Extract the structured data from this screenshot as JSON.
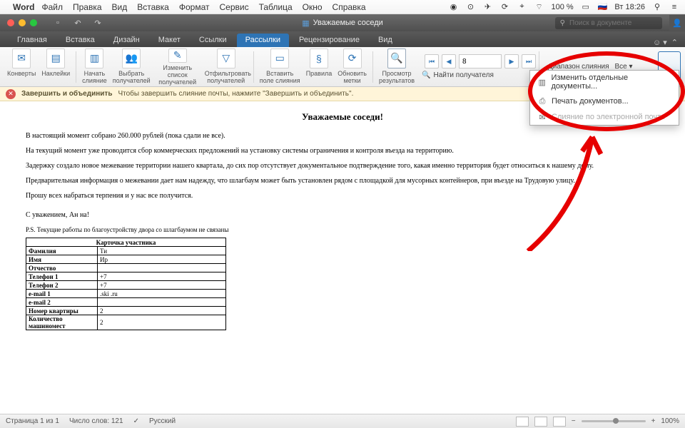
{
  "menubar": {
    "app": "Word",
    "items": [
      "Файл",
      "Правка",
      "Вид",
      "Вставка",
      "Формат",
      "Сервис",
      "Таблица",
      "Окно",
      "Справка"
    ],
    "battery": "100 %",
    "flag": "🇷🇺",
    "daytime": "Вт 18:26"
  },
  "window": {
    "title": "Уважаемые соседи",
    "search_placeholder": "Поиск в документе"
  },
  "tabs": [
    "Главная",
    "Вставка",
    "Дизайн",
    "Макет",
    "Ссылки",
    "Рассылки",
    "Рецензирование",
    "Вид"
  ],
  "ribbon": {
    "konverty": "Конверты",
    "nakleiki": "Наклейки",
    "nachat": "Начать\nслияние",
    "vybrat": "Выбрать\nполучателей",
    "izmenit": "Изменить список\nполучателей",
    "otfilt": "Отфильтровать\nполучателей",
    "vstavit": "Вставить\nполе слияния",
    "pravila": "Правила",
    "obnovit": "Обновить\nметки",
    "prosmotr": "Просмотр\nрезультатов",
    "naiti": "Найти получателя",
    "record": "8",
    "diapazon": "Диапазон слияния",
    "vse": "Все"
  },
  "infobar": {
    "title": "Завершить и объединить",
    "text": "Чтобы завершить слияние почты, нажмите \"Завершить и объединить\"."
  },
  "dropdown": {
    "edit": "Изменить отдельные документы...",
    "print": "Печать документов...",
    "email": "Слияние по электронной почте"
  },
  "document": {
    "heading": "Уважаемые соседи!",
    "p1": "В настоящий момент собрано 260.000 рублей (пока сдали не все).",
    "p2": "На текущий момент уже проводится сбор коммерческих предложений на установку системы ограничения и контроля въезда на территорию.",
    "p3": "Задержку создало новое межевание территории нашего квартала, до сих пор отсутствует документальное подтверждение того, какая именно территория будет относиться к нашему дому.",
    "p4": "Предварительная информация о межевании дает нам надежду, что шлагбаум может быть установлен рядом с площадкой для мусорных контейнеров, при въезде на Трудовую улицу.",
    "p5": "Прошу всех набраться терпения и у нас все получится.",
    "sign": "С уважением, Ан                  на!",
    "ps": "P.S. Текущие работы по благоустройству двора со шлагбаумом не связаны",
    "card_title": "Карточка участника",
    "rows": [
      {
        "l": "Фамилия",
        "v": "Ти"
      },
      {
        "l": "Имя",
        "v": "Ир"
      },
      {
        "l": "Отчество",
        "v": ""
      },
      {
        "l": "Телефон 1",
        "v": "+7"
      },
      {
        "l": "Телефон 2",
        "v": "+7"
      },
      {
        "l": "e-mail 1",
        "v": ".ski                    .ru"
      },
      {
        "l": "e-mail 2",
        "v": ""
      },
      {
        "l": "Номер квартиры",
        "v": "2"
      },
      {
        "l": "Количество машиномест",
        "v": "2"
      }
    ]
  },
  "statusbar": {
    "page": "Страница 1 из 1",
    "words": "Число слов: 121",
    "lang": "Русский",
    "zoom": "100%"
  }
}
